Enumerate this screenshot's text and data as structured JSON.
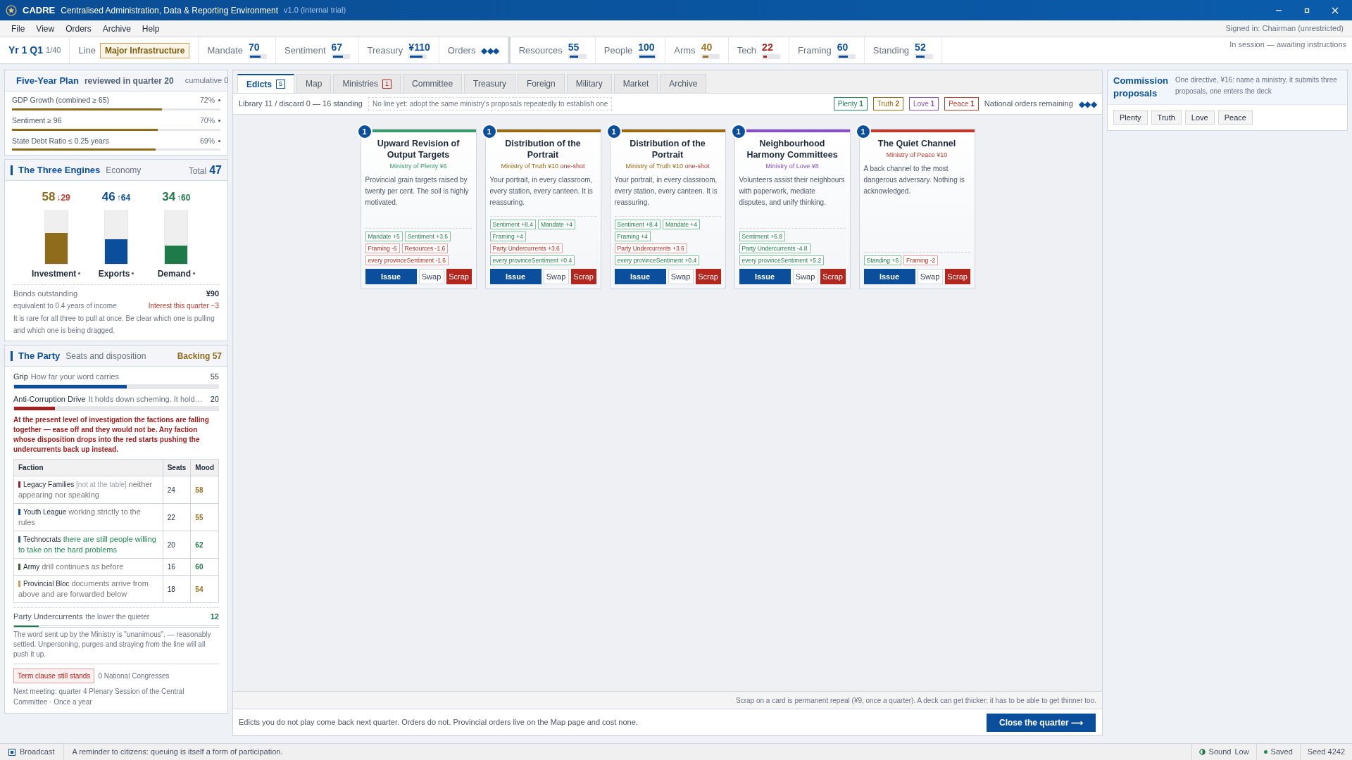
{
  "window": {
    "app_name": "CADRE",
    "title": "Centralised Administration, Data & Reporting Environment",
    "version": "v1.0 (internal trial)"
  },
  "menu": [
    "File",
    "View",
    "Orders",
    "Archive",
    "Help"
  ],
  "signed_in": "Signed in: Chairman (unrestricted)",
  "session_status": "In session — awaiting instructions",
  "period": {
    "label": "Yr 1 Q1",
    "count": "1/40"
  },
  "line": {
    "label": "Line",
    "value": "Major Infrastructure"
  },
  "stats": [
    {
      "kind": "meter",
      "label": "Mandate",
      "value": "70",
      "level": 0.7,
      "color": "#0b4f9c"
    },
    {
      "kind": "meter",
      "label": "Sentiment",
      "value": "67",
      "level": 0.67,
      "color": "#0b4f9c"
    },
    {
      "kind": "meter",
      "label": "Treasury",
      "value": "¥110",
      "level": 0.8,
      "color": "#0b4f9c"
    },
    {
      "kind": "orders",
      "label": "Orders",
      "value": "◆◆◆",
      "color": "#0b4f9c"
    }
  ],
  "resources": [
    {
      "kind": "meter",
      "label": "Resources",
      "value": "55",
      "level": 0.55,
      "color": "#0b4f9c"
    },
    {
      "kind": "meter",
      "label": "People",
      "value": "100",
      "level": 1.0,
      "color": "#0b4f9c"
    },
    {
      "kind": "meter",
      "label": "Arms",
      "value": "40",
      "level": 0.4,
      "color": "#9a7420"
    },
    {
      "kind": "meter",
      "label": "Tech",
      "value": "22",
      "level": 0.22,
      "color": "#b3261e"
    },
    {
      "kind": "meter",
      "label": "Framing",
      "value": "60",
      "level": 0.6,
      "color": "#0b4f9c"
    },
    {
      "kind": "meter",
      "label": "Standing",
      "value": "52",
      "level": 0.52,
      "color": "#0b4f9c"
    }
  ],
  "five_year_plan": {
    "title": "Five-Year Plan",
    "subtitle": "reviewed in quarter 20",
    "note": "cumulative 0",
    "goals": [
      {
        "label": "GDP Growth (combined ≥ 65)",
        "reading": "72%",
        "level": 0.72
      },
      {
        "label": "Sentiment ≥ 96",
        "reading": "70%",
        "level": 0.7
      },
      {
        "label": "State Debt Ratio ≤ 0.25 years",
        "reading": "69%",
        "level": 0.69
      }
    ]
  },
  "engines": {
    "title": "The Three Engines",
    "subtitle": "Economy",
    "total_label": "Total",
    "total_value": "47",
    "items": [
      {
        "name": "Investment",
        "value": "58",
        "delta": {
          "text": "↓29",
          "color": "#c0392b"
        },
        "level": 0.58,
        "color": "#8f6b1c"
      },
      {
        "name": "Exports",
        "value": "46",
        "delta": {
          "text": "↑64",
          "color": "#0b4f9c"
        },
        "level": 0.46,
        "color": "#0b4f9c"
      },
      {
        "name": "Demand",
        "value": "34",
        "delta": {
          "text": "↑60",
          "color": "#1f7a4a"
        },
        "level": 0.34,
        "color": "#1f7a4a"
      }
    ],
    "bonds_label": "Bonds outstanding",
    "bonds_value": "¥90",
    "bonds_note": "equivalent to 0.4 years of income",
    "interest": "Interest this quarter −3",
    "remark": "It is rare for all three to pull at once. Be clear which one is pulling and which one is being dragged."
  },
  "party": {
    "title": "The Party",
    "subtitle": "Seats and disposition",
    "backing": "Backing 57",
    "meters": [
      {
        "label": "Grip",
        "hint": "How far your word carries",
        "reading": "55",
        "level": 0.55,
        "color": "#0b4f9c"
      },
      {
        "label": "Anti-Corruption Drive",
        "hint": "It holds down scheming. It hold…",
        "reading": "20",
        "level": 0.2,
        "color": "#a32020"
      }
    ],
    "warning": "At the present level of investigation the factions are falling together — ease off and they would not be. Any faction whose disposition drops into the red starts pushing the undercurrents back up instead.",
    "columns": [
      "Faction",
      "Seats",
      "Mood"
    ],
    "factions": [
      {
        "name": "Legacy Families",
        "tag": "[not at the table]",
        "note": {
          "text": "neither appearing nor speaking",
          "color": "#777777"
        },
        "color": "#a32020",
        "seats": "24",
        "mood": {
          "text": "58",
          "color": "#9a7420"
        }
      },
      {
        "name": "Youth League",
        "note": {
          "text": "working strictly to the rules",
          "color": "#777777"
        },
        "color": "#0b4f9c",
        "seats": "22",
        "mood": {
          "text": "55",
          "color": "#9a7420"
        }
      },
      {
        "name": "Technocrats",
        "note": {
          "text": "there are still people willing to take on the hard problems",
          "color": "#1f8a55"
        },
        "color": "#3b5b8c",
        "seats": "20",
        "mood": {
          "text": "62",
          "color": "#1f7a4a"
        }
      },
      {
        "name": "Army",
        "note": {
          "text": "drill continues as before",
          "color": "#777777"
        },
        "color": "#3f5f3a",
        "seats": "16",
        "mood": {
          "text": "60",
          "color": "#1f7a4a"
        }
      },
      {
        "name": "Provincial Bloc",
        "note": {
          "text": "documents arrive from above and are forwarded below",
          "color": "#777777"
        },
        "color": "#c9a060",
        "seats": "18",
        "mood": {
          "text": "54",
          "color": "#9a7420"
        }
      }
    ],
    "undercurrents": {
      "label": "Party Undercurrents",
      "hint": "the lower the quieter",
      "value": "12",
      "level": 0.12,
      "text": "The word sent up by the Ministry is \"unanimous\". — reasonably settled. Unpersoning, purges and straying from the line will all push it up."
    },
    "term_clause": "Term clause still stands",
    "congresses": "0 National Congresses",
    "next_meeting": "Next meeting: quarter 4 Plenary Session of the Central Committee · Once a year"
  },
  "tabs": [
    {
      "label": "Edicts",
      "badge": {
        "text": "5",
        "color": "#0b4f9c"
      },
      "selected": true
    },
    {
      "label": "Map",
      "selected": false
    },
    {
      "label": "Ministries",
      "badge": {
        "text": "1",
        "color": "#b3261e"
      },
      "selected": false
    },
    {
      "label": "Committee",
      "selected": false
    },
    {
      "label": "Treasury",
      "selected": false
    },
    {
      "label": "Foreign",
      "selected": false
    },
    {
      "label": "Military",
      "selected": false
    },
    {
      "label": "Market",
      "selected": false
    },
    {
      "label": "Archive",
      "selected": false
    }
  ],
  "library": {
    "summary": "Library 11 / discard 0 — 16 standing",
    "hint": "No line yet: adopt the same ministry's proposals repeatedly to establish one",
    "ministries": [
      {
        "label": "Plenty",
        "count": "1",
        "color": "#1f8a55"
      },
      {
        "label": "Truth",
        "count": "2",
        "color": "#9a6a10"
      },
      {
        "label": "Love",
        "count": "1",
        "color": "#8a4fc7"
      },
      {
        "label": "Peace",
        "count": "1",
        "color": "#c0392b"
      }
    ],
    "orders_label": "National orders remaining",
    "orders": "◆◆◆"
  },
  "cards": [
    {
      "badge": "1",
      "title": "Upward Revision of Output Targets",
      "ministry": "Ministry of Plenty",
      "cost": "¥6",
      "color": "#3a9a6a",
      "text": "Provincial grain targets raised by twenty per cent. The soil is highly motivated.",
      "effects": [
        {
          "text": "Mandate +5",
          "kind": "good"
        },
        {
          "text": "Sentiment +3.6",
          "kind": "good"
        },
        {
          "text": "Framing -6",
          "kind": "bad"
        },
        {
          "text": "Resources -1.6",
          "kind": "bad"
        },
        {
          "text": "every provinceSentiment -1.6",
          "kind": "bad"
        }
      ],
      "buttons": [
        "Issue",
        "Swap",
        "Scrap"
      ]
    },
    {
      "badge": "1",
      "title": "Distribution of the Portrait",
      "ministry": "Ministry of Truth",
      "cost": "¥10",
      "tag": "one-shot",
      "color": "#9a6a10",
      "text": "Your portrait, in every classroom, every station, every canteen. It is reassuring.",
      "effects": [
        {
          "text": "Sentiment +8.4",
          "kind": "good"
        },
        {
          "text": "Mandate +4",
          "kind": "good"
        },
        {
          "text": "Framing +4",
          "kind": "good"
        },
        {
          "text": "Party Undercurrents +3.6",
          "kind": "bad"
        },
        {
          "text": "every provinceSentiment +0.4",
          "kind": "good"
        }
      ],
      "buttons": [
        "Issue",
        "Swap",
        "Scrap"
      ]
    },
    {
      "badge": "1",
      "title": "Distribution of the Portrait",
      "ministry": "Ministry of Truth",
      "cost": "¥10",
      "tag": "one-shot",
      "color": "#9a6a10",
      "text": "Your portrait, in every classroom, every station, every canteen. It is reassuring.",
      "effects": [
        {
          "text": "Sentiment +8.4",
          "kind": "good"
        },
        {
          "text": "Mandate +4",
          "kind": "good"
        },
        {
          "text": "Framing +4",
          "kind": "good"
        },
        {
          "text": "Party Undercurrents +3.6",
          "kind": "bad"
        },
        {
          "text": "every provinceSentiment +0.4",
          "kind": "good"
        }
      ],
      "buttons": [
        "Issue",
        "Swap",
        "Scrap"
      ]
    },
    {
      "badge": "1",
      "title": "Neighbourhood Harmony Committees",
      "ministry": "Ministry of Love",
      "cost": "¥8",
      "color": "#8a4fc7",
      "text": "Volunteers assist their neighbours with paperwork, mediate disputes, and unify thinking.",
      "effects": [
        {
          "text": "Sentiment +6.8",
          "kind": "good"
        },
        {
          "text": "Party Undercurrents -4.8",
          "kind": "good"
        },
        {
          "text": "every provinceSentiment +5.2",
          "kind": "good"
        }
      ],
      "buttons": [
        "Issue",
        "Swap",
        "Scrap"
      ]
    },
    {
      "badge": "1",
      "title": "The Quiet Channel",
      "ministry": "Ministry of Peace",
      "cost": "¥10",
      "color": "#c0392b",
      "text": "A back channel to the most dangerous adversary. Nothing is acknowledged.",
      "effects": [
        {
          "text": "Standing +6",
          "kind": "good"
        },
        {
          "text": "Framing -2",
          "kind": "bad"
        }
      ],
      "buttons": [
        "Issue",
        "Swap",
        "Scrap"
      ]
    }
  ],
  "scrap_note": "Scrap on a card is permanent repeal (¥9, once a quarter). A deck can get thicker; it has to be able to get thinner too.",
  "footer_text": "Edicts you do not play come back next quarter. Orders do not. Provincial orders live on the Map page and cost none.",
  "close_button": "Close the quarter ⟶",
  "commission": {
    "title": "Commission proposals",
    "text": "One directive, ¥16: name a ministry, it submits three proposals, one enters the deck",
    "buttons": [
      "Plenty",
      "Truth",
      "Love",
      "Peace"
    ]
  },
  "status_bar": {
    "broadcast": "Broadcast",
    "message": "A reminder to citizens: queuing is itself a form of participation.",
    "sound_label": "Sound",
    "sound_value": "Low",
    "saved": "Saved",
    "seed": "Seed 4242"
  }
}
